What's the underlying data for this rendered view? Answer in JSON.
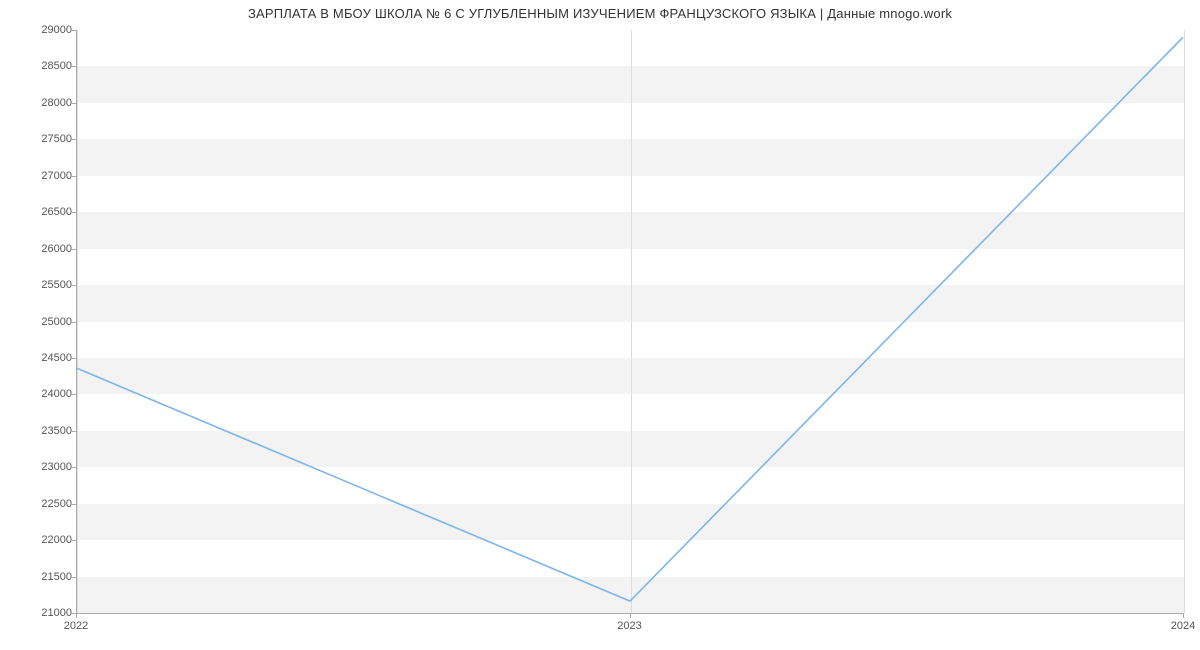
{
  "chart_data": {
    "type": "line",
    "title": "ЗАРПЛАТА В МБОУ ШКОЛА № 6 С УГЛУБЛЕННЫМ ИЗУЧЕНИЕМ ФРАНЦУЗСКОГО ЯЗЫКА | Данные mnogo.work",
    "xlabel": "",
    "ylabel": "",
    "x": [
      2022,
      2023,
      2024
    ],
    "values": [
      24350,
      21150,
      28900
    ],
    "x_ticks": [
      2022,
      2023,
      2024
    ],
    "y_ticks": [
      21000,
      21500,
      22000,
      22500,
      23000,
      23500,
      24000,
      24500,
      25000,
      25500,
      26000,
      26500,
      27000,
      27500,
      28000,
      28500,
      29000
    ],
    "xlim": [
      2022,
      2024
    ],
    "ylim": [
      21000,
      29000
    ],
    "colors": {
      "line": "#7cb5ec",
      "band": "#f3f3f3"
    }
  }
}
